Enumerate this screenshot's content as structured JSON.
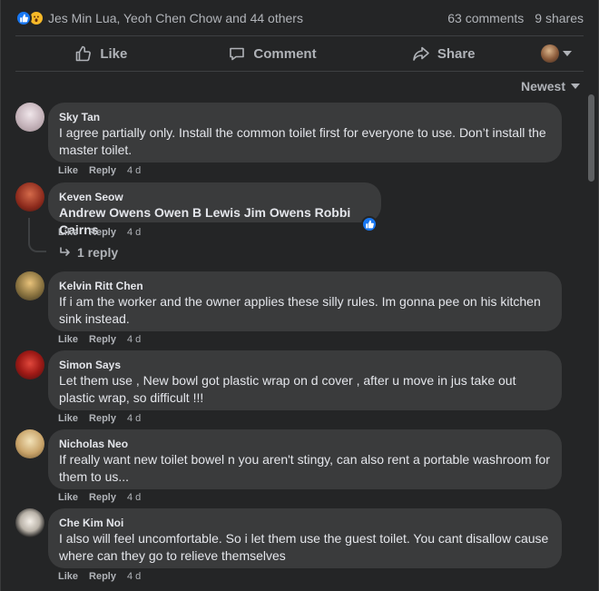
{
  "reactions": {
    "names": "Jes Min Lua, Yeoh Chen Chow and 44 others",
    "comments": "63 comments",
    "shares": "9 shares",
    "icons": [
      "like-reaction-icon",
      "wow-reaction-icon"
    ]
  },
  "actions": {
    "like": "Like",
    "comment": "Comment",
    "share": "Share"
  },
  "sort": {
    "label": "Newest"
  },
  "comments": [
    {
      "author": "Sky Tan",
      "text": "I agree partially only. Install the common toilet first for everyone to use. Don’t install the master toilet.",
      "like": "Like",
      "reply": "Reply",
      "time": "4 d"
    },
    {
      "author": "Keven Seow",
      "text": "Andrew Owens Owen B Lewis Jim Owens Robbi Cairns",
      "like": "Like",
      "reply": "Reply",
      "time": "4 d",
      "replies": "1 reply"
    },
    {
      "author": "Kelvin Ritt Chen",
      "text": "If i am the worker and the owner applies these silly rules. Im gonna pee on his kitchen sink instead.",
      "like": "Like",
      "reply": "Reply",
      "time": "4 d"
    },
    {
      "author": "Simon Says",
      "text": "Let them use , New bowl got plastic wrap on d cover , after u move in jus take out plastic wrap, so difficult !!!",
      "like": "Like",
      "reply": "Reply",
      "time": "4 d"
    },
    {
      "author": "Nicholas Neo",
      "text": "If really want new toilet bowel n you aren't stingy, can also rent a portable washroom for them to us...",
      "like": "Like",
      "reply": "Reply",
      "time": "4 d"
    },
    {
      "author": "Che Kim Noi",
      "text": "I also will feel uncomfortable. So i let them use the guest toilet. You cant disallow cause where can they go to relieve themselves",
      "like": "Like",
      "reply": "Reply",
      "time": "4 d"
    }
  ],
  "colors": {
    "background": "#242526",
    "bubble": "#3a3b3c",
    "accent": "#1877f2",
    "secondary_text": "#b0b3b8"
  }
}
